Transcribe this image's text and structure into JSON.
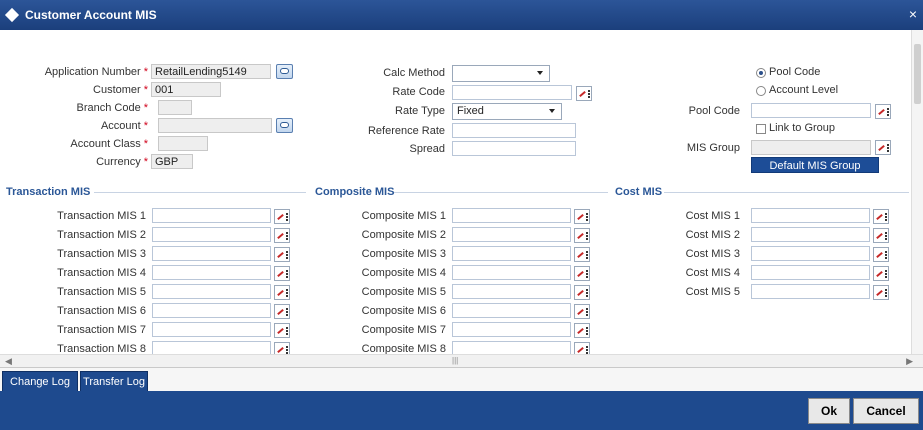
{
  "window": {
    "title": "Customer Account MIS",
    "close_glyph": "×"
  },
  "main": {
    "application_number": {
      "label": "Application Number",
      "value": "RetailLending5149"
    },
    "customer": {
      "label": "Customer",
      "value": "001"
    },
    "branch_code": {
      "label": "Branch Code",
      "value": ""
    },
    "account": {
      "label": "Account",
      "value": ""
    },
    "account_class": {
      "label": "Account Class",
      "value": ""
    },
    "currency": {
      "label": "Currency",
      "value": "GBP"
    },
    "calc_method": {
      "label": "Calc Method",
      "value": ""
    },
    "rate_code": {
      "label": "Rate Code",
      "value": ""
    },
    "rate_type": {
      "label": "Rate Type",
      "value": "Fixed"
    },
    "reference_rate": {
      "label": "Reference Rate",
      "value": ""
    },
    "spread": {
      "label": "Spread",
      "value": ""
    },
    "pool_code_radio": {
      "label": "Pool Code",
      "selected": true
    },
    "account_level_radio": {
      "label": "Account Level",
      "selected": false
    },
    "pool_code": {
      "label": "Pool Code",
      "value": ""
    },
    "link_to_group": {
      "label": "Link to Group",
      "checked": false
    },
    "mis_group": {
      "label": "MIS Group",
      "value": ""
    },
    "default_mis_group_button": "Default MIS Group"
  },
  "sections": {
    "transaction": {
      "title": "Transaction MIS",
      "labels": [
        "Transaction MIS 1",
        "Transaction MIS 2",
        "Transaction MIS 3",
        "Transaction MIS 4",
        "Transaction MIS 5",
        "Transaction MIS 6",
        "Transaction MIS 7",
        "Transaction MIS 8"
      ]
    },
    "composite": {
      "title": "Composite MIS",
      "labels": [
        "Composite MIS 1",
        "Composite MIS 2",
        "Composite MIS 3",
        "Composite MIS 4",
        "Composite MIS 5",
        "Composite MIS 6",
        "Composite MIS 7",
        "Composite MIS 8"
      ]
    },
    "cost": {
      "title": "Cost MIS",
      "labels": [
        "Cost MIS 1",
        "Cost MIS 2",
        "Cost MIS 3",
        "Cost MIS 4",
        "Cost MIS 5"
      ]
    }
  },
  "tabs": [
    "Change Log",
    "Transfer Log"
  ],
  "footer": {
    "ok": "Ok",
    "cancel": "Cancel"
  },
  "colors": {
    "title_bar": "#1b3f7c",
    "footer": "#1e4a8e",
    "section_text": "#2b5797",
    "required": "#d0021b"
  }
}
